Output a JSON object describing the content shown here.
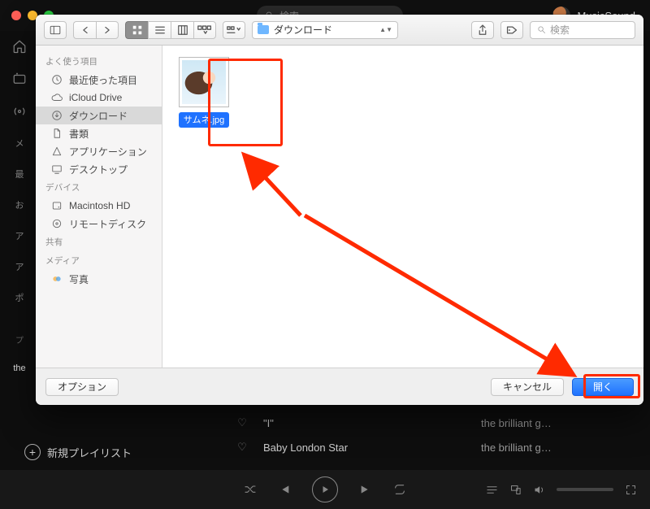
{
  "background": {
    "search_placeholder": "検索",
    "user_name": "MusicSound",
    "sidebar_letters": [
      "メ",
      "最",
      "お",
      "ア",
      "ア",
      "ポ"
    ],
    "sidebar_small": [
      "プ",
      "the"
    ],
    "new_playlist": "新規プレイリスト",
    "tracks": [
      {
        "title": "\"I\"",
        "artist": "the brilliant g…"
      },
      {
        "title": "Baby London Star",
        "artist": "the brilliant g…"
      }
    ]
  },
  "panel": {
    "path_label": "ダウンロード",
    "search_placeholder": "検索",
    "sidebar": {
      "sections": [
        {
          "header": "よく使う項目",
          "items": [
            {
              "icon": "clock-icon",
              "label": "最近使った項目"
            },
            {
              "icon": "cloud-icon",
              "label": "iCloud Drive"
            },
            {
              "icon": "download-icon",
              "label": "ダウンロード",
              "selected": true
            },
            {
              "icon": "doc-icon",
              "label": "書類"
            },
            {
              "icon": "app-icon",
              "label": "アプリケーション"
            },
            {
              "icon": "desktop-icon",
              "label": "デスクトップ"
            }
          ]
        },
        {
          "header": "デバイス",
          "items": [
            {
              "icon": "disk-icon",
              "label": "Macintosh HD"
            },
            {
              "icon": "remotedisk-icon",
              "label": "リモートディスク"
            }
          ]
        },
        {
          "header": "共有",
          "items": []
        },
        {
          "header": "メディア",
          "items": [
            {
              "icon": "photos-icon",
              "label": "写真"
            }
          ]
        }
      ]
    },
    "file_name": "サムネ.jpg",
    "buttons": {
      "options": "オプション",
      "cancel": "キャンセル",
      "open": "開く"
    }
  }
}
